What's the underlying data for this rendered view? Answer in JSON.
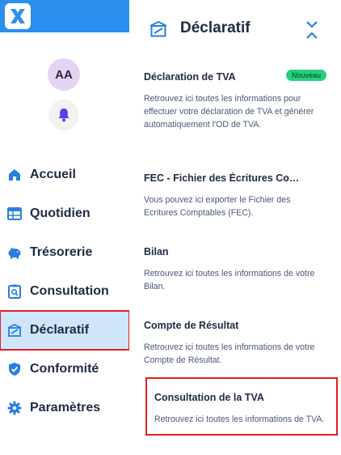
{
  "colors": {
    "brand": "#2b8ff0",
    "active_bg": "#cfe5fa",
    "highlight_border": "#e02020",
    "badge_bg": "#25d07c",
    "icon_blue": "#2b7de0"
  },
  "user": {
    "initials": "AA"
  },
  "sidebar": {
    "items": [
      {
        "label": "Accueil",
        "icon": "home-icon"
      },
      {
        "label": "Quotidien",
        "icon": "calendar-grid-icon"
      },
      {
        "label": "Trésorerie",
        "icon": "piggy-bank-icon"
      },
      {
        "label": "Consultation",
        "icon": "clipboard-search-icon"
      },
      {
        "label": "Déclaratif",
        "icon": "declaration-icon",
        "active": true
      },
      {
        "label": "Conformité",
        "icon": "shield-check-icon"
      },
      {
        "label": "Paramètres",
        "icon": "gear-icon"
      }
    ]
  },
  "panel": {
    "title": "Déclaratif",
    "items": [
      {
        "title": "Déclaration de TVA",
        "badge": "Nouveau",
        "description": "Retrouvez ici toutes les informations pour effectuer votre déclaration de TVA et générer automatiquement l'OD de TVA."
      },
      {
        "title": "FEC - Fichier des Écritures Comptables",
        "description": "Vous pouvez ici exporter le Fichier des Ecritures Comptables (FEC)."
      },
      {
        "title": "Bilan",
        "description": "Retrouvez ici toutes les informations de votre Bilan."
      },
      {
        "title": "Compte de Résultat",
        "description": "Retrouvez ici toutes les informations de votre Compte de Résultat."
      },
      {
        "title": "Consultation de la TVA",
        "description": "Retrouvez ici toutes les informations de TVA."
      }
    ]
  }
}
